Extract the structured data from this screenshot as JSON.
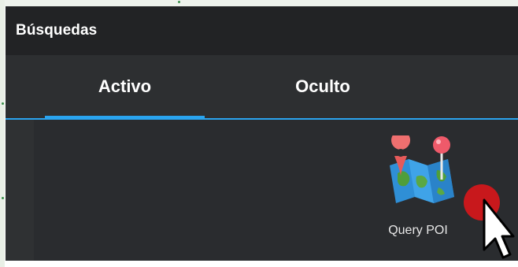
{
  "window": {
    "title": "Búsquedas"
  },
  "tabs": [
    {
      "label": "Activo",
      "active": true
    },
    {
      "label": "Oculto",
      "active": false
    }
  ],
  "tiles": [
    {
      "label": "Query POI",
      "icon": "map-poi-icon"
    }
  ],
  "colors": {
    "accent": "#2aa4ef",
    "title_bar": "#222325",
    "panel": "#2a2c2f",
    "badge": "#c8181c"
  }
}
